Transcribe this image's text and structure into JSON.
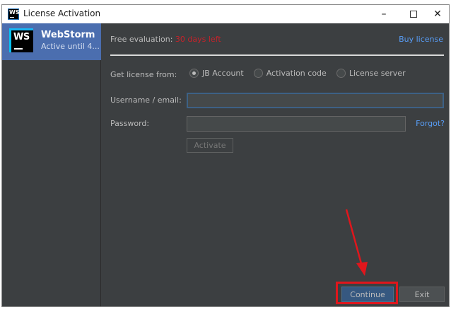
{
  "window": {
    "title": "License Activation",
    "minimize_label": "–",
    "close_label": "✕"
  },
  "sidebar": {
    "product": {
      "logo_text": "WS",
      "name": "WebStorm",
      "subtitle": "Active until 4..."
    }
  },
  "main": {
    "eval_prefix": "Free evaluation: ",
    "eval_days": "30 days left",
    "buy_license": "Buy license",
    "get_license_label": "Get license from:",
    "options": [
      {
        "label": "JB Account",
        "checked": true
      },
      {
        "label": "Activation code",
        "checked": false
      },
      {
        "label": "License server",
        "checked": false
      }
    ],
    "username_label": "Username / email:",
    "username_value": "",
    "password_label": "Password:",
    "password_value": "",
    "forgot": "Forgot?",
    "activate": "Activate",
    "continue": "Continue",
    "exit": "Exit"
  },
  "colors": {
    "accent": "#589df6",
    "selection": "#4b6eaf",
    "annotation": "#e0161c",
    "warning": "#c7222a"
  }
}
